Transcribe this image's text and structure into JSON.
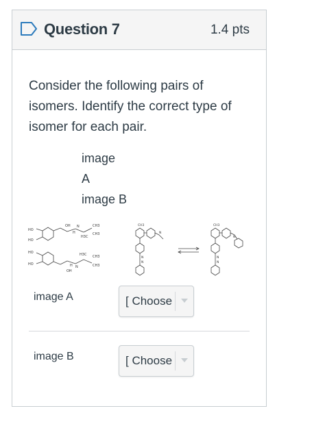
{
  "question": {
    "title": "Question 7",
    "points": "1.4 pts",
    "prompt": "Consider the following pairs of isomers. Identify the correct type of isomer for each pair.",
    "image_labels": [
      "image",
      "A",
      "image B"
    ]
  },
  "figure": {
    "left_molecule_labels": [
      "HO",
      "HO",
      "OH",
      "H",
      "N",
      "CH3",
      "H3C",
      "CH3",
      "HO",
      "HO",
      "H3C",
      "CH3",
      "CH3",
      "N",
      "H",
      "OH"
    ],
    "right_molecule_labels": [
      "CH3",
      "N",
      "N",
      "N",
      "CH3",
      "N",
      "N",
      "N"
    ]
  },
  "answers": [
    {
      "label": "image A",
      "select_value": "[ Choose"
    },
    {
      "label": "image B",
      "select_value": "[ Choose"
    }
  ],
  "colors": {
    "border": "#c7cdd1",
    "header_bg": "#f5f5f5",
    "text": "#2d3b45",
    "select_bg": "#f5f5f5"
  },
  "icons": {
    "flag": "flag-icon",
    "dropdown": "caret-down-icon"
  }
}
